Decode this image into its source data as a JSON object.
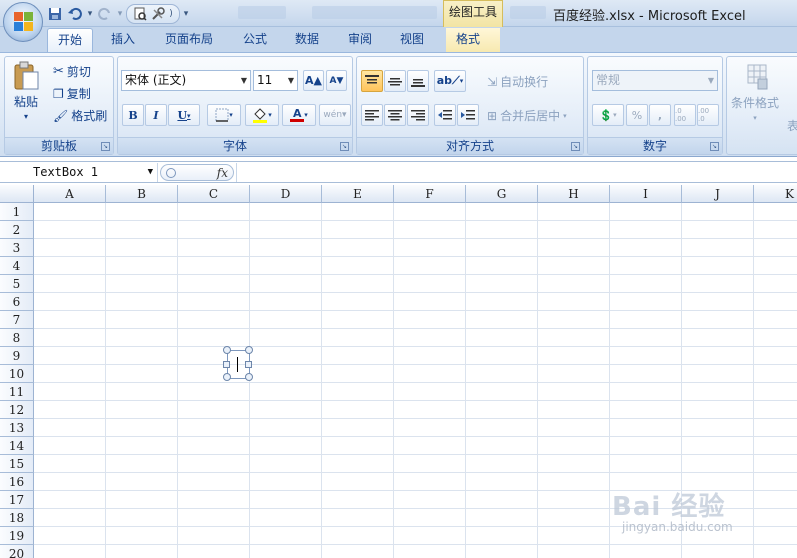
{
  "window": {
    "title": "百度经验.xlsx - Microsoft Excel",
    "context_tab_group": "绘图工具"
  },
  "quick_access": {
    "icons": [
      "save-icon",
      "undo-icon",
      "redo-icon",
      "print-preview-icon",
      "tools-icon",
      "customize-icon"
    ]
  },
  "ribbon_tabs": [
    {
      "label": "开始",
      "active": true
    },
    {
      "label": "插入"
    },
    {
      "label": "页面布局"
    },
    {
      "label": "公式"
    },
    {
      "label": "数据"
    },
    {
      "label": "审阅"
    },
    {
      "label": "视图"
    },
    {
      "label": "格式",
      "contextual": true
    }
  ],
  "clipboard": {
    "paste": "粘贴",
    "cut": "剪切",
    "copy": "复制",
    "format_painter": "格式刷",
    "label": "剪贴板"
  },
  "font": {
    "name": "宋体 (正文)",
    "size": "11",
    "grow": "A",
    "shrink": "A",
    "bold": "B",
    "italic": "I",
    "underline": "U",
    "font_color_letter": "A",
    "phonetic": "wén",
    "label": "字体",
    "colors": {
      "fill": "#ffff00",
      "font": "#d00000"
    }
  },
  "alignment": {
    "wrap_text": "自动换行",
    "merge_center": "合并后居中",
    "label": "对齐方式"
  },
  "number": {
    "format": "常规",
    "percent": "%",
    "comma": ",",
    "inc_decimal": ".0 .00",
    "dec_decimal": ".00 .0",
    "label": "数字"
  },
  "styles": {
    "conditional": "条件格式",
    "table_partial": "表"
  },
  "formula_bar": {
    "name_box": "TextBox 1",
    "fx": "fx",
    "content": ""
  },
  "sheet": {
    "columns": [
      "A",
      "B",
      "C",
      "D",
      "E",
      "F",
      "G",
      "H",
      "I",
      "J",
      "K"
    ],
    "rows": [
      "1",
      "2",
      "3",
      "4",
      "5",
      "6",
      "7",
      "8",
      "9",
      "10",
      "11",
      "12",
      "13",
      "14",
      "15",
      "16",
      "17",
      "18",
      "19",
      "20"
    ]
  },
  "watermark": {
    "text": "Bai 经验",
    "sub": "jingyan.baidu.com"
  }
}
